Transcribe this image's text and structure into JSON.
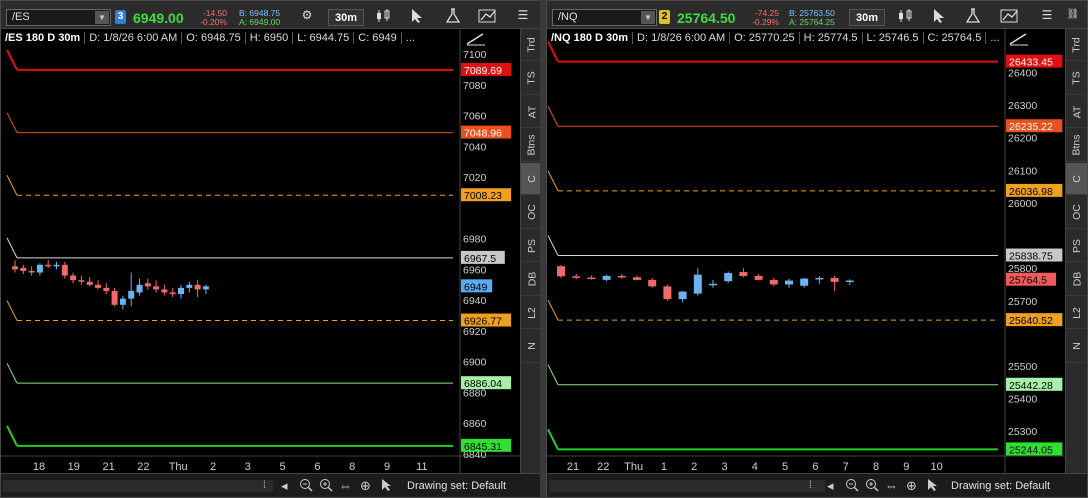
{
  "panels": [
    {
      "symbol": "/ES",
      "link_number": "3",
      "link_color": "#2f7fd6",
      "last_price": "6949.00",
      "net_change": "-14.50",
      "pct_change": "-0.20%",
      "bid": "B: 6948.75",
      "ask": "A: 6949.00",
      "timeframe": "30m",
      "info": {
        "title": "/ES 180 D 30m",
        "date": "D: 1/8/26 6:00 AM",
        "open": "O: 6948.75",
        "high": "H: 6950",
        "low": "L: 6944.75",
        "close": "C: 6949",
        "more": "..."
      },
      "y_ticks": [
        "7100",
        "7080",
        "7060",
        "7040",
        "7020",
        "6980",
        "6960",
        "6940",
        "6920",
        "6900",
        "6880",
        "6860",
        "6840"
      ],
      "y_tick_values": [
        7100,
        7080,
        7060,
        7040,
        7020,
        6980,
        6960,
        6940,
        6920,
        6900,
        6880,
        6860,
        6840
      ],
      "y_range": [
        6840,
        7102
      ],
      "x_ticks": [
        "18",
        "19",
        "21",
        "22",
        "Thu",
        "2",
        "3",
        "5",
        "6",
        "8",
        "9",
        "11"
      ],
      "levels": [
        {
          "label": "7089.69",
          "value": 7089.69,
          "color": "#e01010",
          "bg": "#e01010",
          "fg": "#ffffff",
          "style": "solid",
          "width": 2
        },
        {
          "label": "7048.96",
          "value": 7048.96,
          "color": "#e8501e",
          "bg": "#e8501e",
          "fg": "#ffffff",
          "style": "solid",
          "width": 1
        },
        {
          "label": "7008.23",
          "value": 7008.23,
          "color": "#f0a020",
          "bg": "#f0a020",
          "fg": "#000000",
          "style": "dash",
          "width": 1
        },
        {
          "label": "6967.5",
          "value": 6967.5,
          "color": "#d8d8d8",
          "bg": "#c8c8c8",
          "fg": "#000000",
          "style": "solid",
          "width": 1
        },
        {
          "label": "6926.77",
          "value": 6926.77,
          "color": "#f0a020",
          "bg": "#f0a020",
          "fg": "#000000",
          "style": "dash",
          "width": 1
        },
        {
          "label": "6886.04",
          "value": 6886.04,
          "color": "#8ee08e",
          "bg": "#a8f0a8",
          "fg": "#000000",
          "style": "solid",
          "width": 1
        },
        {
          "label": "6845.31",
          "value": 6845.31,
          "color": "#20d020",
          "bg": "#30e030",
          "fg": "#000000",
          "style": "solid",
          "width": 2
        }
      ],
      "current": {
        "label": "6949",
        "value": 6949,
        "bg": "#5aaaf0",
        "fg": "#000000"
      },
      "footer_text": "Drawing set: Default"
    },
    {
      "symbol": "/NQ",
      "link_number": "2",
      "link_color": "#e0c020",
      "last_price": "25764.50",
      "net_change": "-74.25",
      "pct_change": "-0.29%",
      "bid": "B: 25763.50",
      "ask": "A: 25764.25",
      "timeframe": "30m",
      "info": {
        "title": "/NQ 180 D 30m",
        "date": "D: 1/8/26 6:00 AM",
        "open": "O: 25770.25",
        "high": "H: 25774.5",
        "low": "L: 25746.5",
        "close": "C: 25764.5",
        "more": "..."
      },
      "y_ticks": [
        "26400",
        "26300",
        "26200",
        "26100",
        "26000",
        "25800",
        "25700",
        "25500",
        "25400",
        "25300"
      ],
      "y_tick_values": [
        26400,
        26300,
        26200,
        26100,
        26000,
        25800,
        25700,
        25500,
        25400,
        25300
      ],
      "y_range": [
        25230,
        26466
      ],
      "x_ticks": [
        "21",
        "22",
        "Thu",
        "1",
        "2",
        "3",
        "4",
        "5",
        "6",
        "7",
        "8",
        "9",
        "10"
      ],
      "levels": [
        {
          "label": "26433.45",
          "value": 26433.45,
          "color": "#e01010",
          "bg": "#e01010",
          "fg": "#ffffff",
          "style": "solid",
          "width": 2
        },
        {
          "label": "26235.22",
          "value": 26235.22,
          "color": "#e8501e",
          "bg": "#e8501e",
          "fg": "#ffffff",
          "style": "solid",
          "width": 1
        },
        {
          "label": "26036.98",
          "value": 26036.98,
          "color": "#f0a020",
          "bg": "#f0a020",
          "fg": "#000000",
          "style": "dash",
          "width": 1
        },
        {
          "label": "25838.75",
          "value": 25838.75,
          "color": "#d8d8d8",
          "bg": "#c8c8c8",
          "fg": "#000000",
          "style": "solid",
          "width": 1
        },
        {
          "label": "25640.52",
          "value": 25640.52,
          "color": "#f0a020",
          "bg": "#f0a020",
          "fg": "#000000",
          "style": "dash",
          "width": 1
        },
        {
          "label": "25442.28",
          "value": 25442.28,
          "color": "#8ee08e",
          "bg": "#a8f0a8",
          "fg": "#000000",
          "style": "solid",
          "width": 1
        },
        {
          "label": "25244.05",
          "value": 25244.05,
          "color": "#20d020",
          "bg": "#30e030",
          "fg": "#000000",
          "style": "solid",
          "width": 2
        }
      ],
      "current": {
        "label": "25764.5",
        "value": 25764.5,
        "bg": "#f05a5a",
        "fg": "#000000"
      },
      "footer_text": "Drawing set: Default"
    }
  ],
  "side_tabs": [
    "Trd",
    "TS",
    "AT",
    "Btns",
    "C",
    "OC",
    "PS",
    "DB",
    "L2",
    "N"
  ],
  "active_tab": "C",
  "chart_data": [
    {
      "type": "candlestick",
      "title": "/ES 180 D 30m",
      "ylim": [
        6840,
        7102
      ],
      "candles_es": [
        [
          6962,
          6966,
          6958,
          6960
        ],
        [
          6961,
          6963,
          6957,
          6959
        ],
        [
          6959,
          6962,
          6956,
          6958
        ],
        [
          6958,
          6964,
          6956,
          6963
        ],
        [
          6963,
          6966,
          6961,
          6962
        ],
        [
          6962,
          6965,
          6960,
          6963
        ],
        [
          6963,
          6965,
          6954,
          6956
        ],
        [
          6956,
          6958,
          6951,
          6953
        ],
        [
          6953,
          6956,
          6950,
          6952
        ],
        [
          6952,
          6955,
          6949,
          6950
        ],
        [
          6950,
          6953,
          6947,
          6948
        ],
        [
          6948,
          6951,
          6944,
          6946
        ],
        [
          6946,
          6948,
          6936,
          6937
        ],
        [
          6937,
          6943,
          6934,
          6941
        ],
        [
          6941,
          6958,
          6936,
          6946
        ],
        [
          6945,
          6954,
          6943,
          6950
        ],
        [
          6951,
          6954,
          6947,
          6949
        ],
        [
          6949,
          6953,
          6945,
          6947
        ],
        [
          6947,
          6950,
          6943,
          6945
        ],
        [
          6945,
          6948,
          6942,
          6944
        ],
        [
          6944,
          6950,
          6941,
          6948
        ],
        [
          6948,
          6952,
          6945,
          6950
        ],
        [
          6950,
          6953,
          6942,
          6947
        ],
        [
          6947,
          6950,
          6944,
          6949
        ]
      ]
    },
    {
      "type": "candlestick",
      "title": "/NQ 180 D 30m",
      "ylim": [
        25230,
        26466
      ],
      "candles_nq": [
        [
          25806,
          25810,
          25770,
          25775
        ],
        [
          25775,
          25782,
          25766,
          25771
        ],
        [
          25771,
          25778,
          25765,
          25768
        ],
        [
          25764,
          25780,
          25760,
          25776
        ],
        [
          25776,
          25782,
          25768,
          25772
        ],
        [
          25772,
          25778,
          25762,
          25764
        ],
        [
          25764,
          25770,
          25740,
          25744
        ],
        [
          25744,
          25750,
          25700,
          25705
        ],
        [
          25705,
          25730,
          25695,
          25728
        ],
        [
          25722,
          25800,
          25716,
          25780
        ],
        [
          25748,
          25764,
          25740,
          25752
        ],
        [
          25760,
          25790,
          25755,
          25785
        ],
        [
          25788,
          25800,
          25772,
          25776
        ],
        [
          25776,
          25782,
          25762,
          25764
        ],
        [
          25764,
          25770,
          25744,
          25750
        ],
        [
          25750,
          25768,
          25740,
          25762
        ],
        [
          25746,
          25770,
          25740,
          25768
        ],
        [
          25766,
          25776,
          25752,
          25770
        ],
        [
          25770,
          25776,
          25730,
          25758
        ],
        [
          25758,
          25766,
          25748,
          25762
        ]
      ]
    }
  ]
}
